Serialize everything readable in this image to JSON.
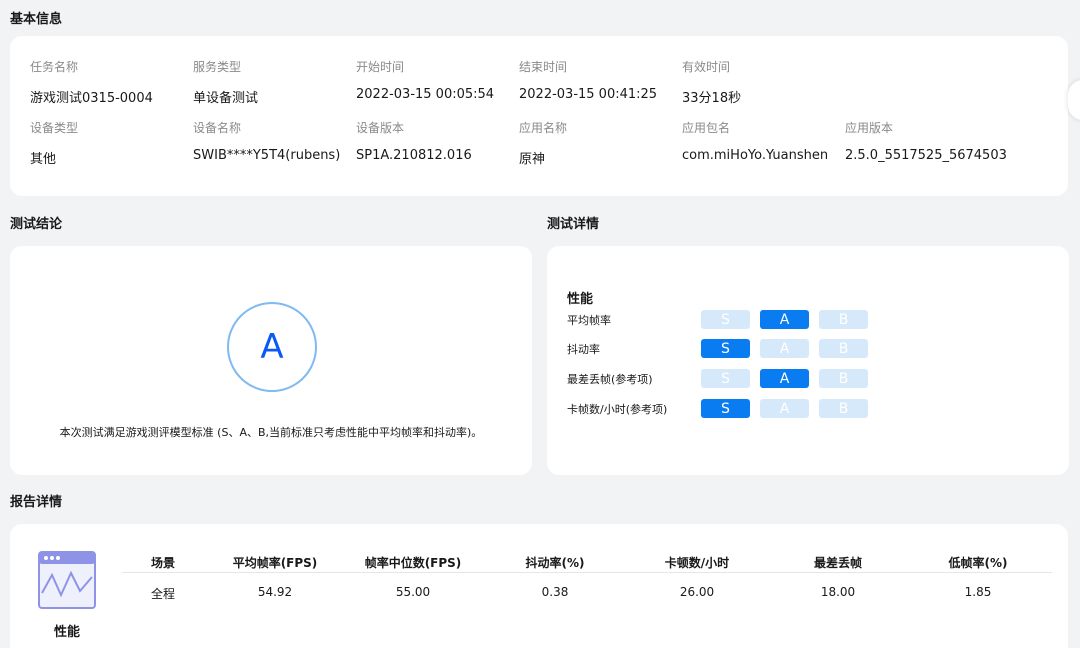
{
  "basic_info": {
    "title": "基本信息",
    "fields": [
      {
        "label": "任务名称",
        "value": "游戏测试0315-0004"
      },
      {
        "label": "服务类型",
        "value": "单设备测试"
      },
      {
        "label": "开始时间",
        "value": "2022-03-15 00:05:54"
      },
      {
        "label": "结束时间",
        "value": "2022-03-15 00:41:25"
      },
      {
        "label": "有效时间",
        "value": "33分18秒"
      },
      {
        "label": "设备类型",
        "value": "其他"
      },
      {
        "label": "设备名称",
        "value": "SWIB****Y5T4(rubens)"
      },
      {
        "label": "设备版本",
        "value": "SP1A.210812.016"
      },
      {
        "label": "应用名称",
        "value": "原神"
      },
      {
        "label": "应用包名",
        "value": "com.miHoYo.Yuanshen"
      },
      {
        "label": "应用版本",
        "value": "2.5.0_5517525_5674503"
      }
    ]
  },
  "conclusion": {
    "title": "测试结论",
    "grade": "A",
    "text": "本次测试满足游戏测评模型标准 (S、A、B,当前标准只考虑性能中平均帧率和抖动率)。"
  },
  "details": {
    "title": "测试详情",
    "heading": "性能",
    "grades": [
      "S",
      "A",
      "B"
    ],
    "metrics": [
      {
        "label": "平均帧率",
        "selected": "A"
      },
      {
        "label": "抖动率",
        "selected": "S"
      },
      {
        "label": "最差丢帧(参考项)",
        "selected": "A"
      },
      {
        "label": "卡帧数/小时(参考项)",
        "selected": "S"
      }
    ]
  },
  "report": {
    "title": "报告详情",
    "icon_label": "性能",
    "columns": [
      "场景",
      "平均帧率(FPS)",
      "帧率中位数(FPS)",
      "抖动率(%)",
      "卡顿数/小时",
      "最差丢帧",
      "低帧率(%)"
    ],
    "rows": [
      [
        "全程",
        "54.92",
        "55.00",
        "0.38",
        "26.00",
        "18.00",
        "1.85"
      ]
    ]
  },
  "colors": {
    "accent": "#0a7cf2",
    "chip_inactive": "#d6e9fb",
    "icon_purple": "#8f93e8"
  }
}
